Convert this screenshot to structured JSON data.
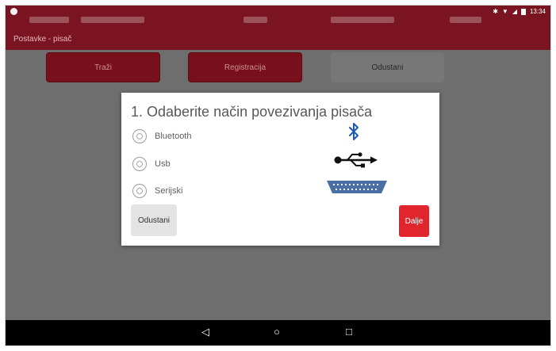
{
  "status_bar": {
    "time": "13:34",
    "icons": [
      "bluetooth-icon",
      "wifi-icon",
      "signal-icon",
      "battery-icon"
    ]
  },
  "breadcrumb": {
    "text": "Postavke - pisač"
  },
  "action_buttons": [
    {
      "label": "Traži"
    },
    {
      "label": "Registracija"
    },
    {
      "label": "Odustani"
    }
  ],
  "dialog": {
    "title": "1. Odaberite način povezivanja pisača",
    "options": [
      {
        "label": "Bluetooth",
        "selected": false,
        "icon": "bluetooth-icon"
      },
      {
        "label": "Usb",
        "selected": false,
        "icon": "usb-icon"
      },
      {
        "label": "Serijski",
        "selected": false,
        "icon": "serial-port-icon"
      }
    ],
    "cancel_label": "Odustani",
    "next_label": "Dalje"
  },
  "nav_bar": {
    "icons": [
      "back-icon",
      "home-icon",
      "recents-icon"
    ]
  },
  "colors": {
    "brand_red": "#7a1420",
    "next_button": "#e1252c",
    "bluetooth_blue": "#1a5ab8",
    "serial_blue": "#4a6fa5"
  }
}
